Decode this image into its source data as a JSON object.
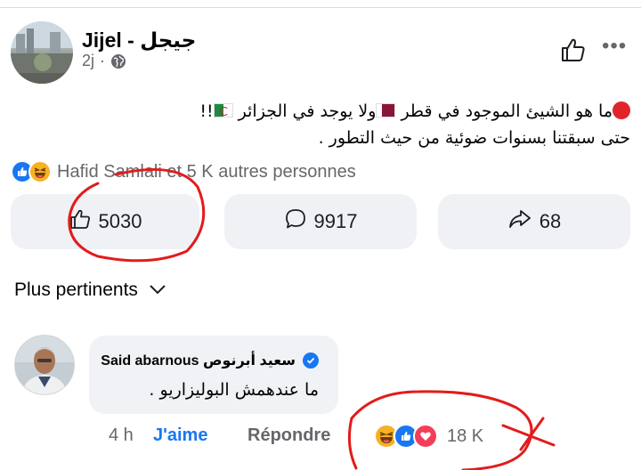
{
  "post": {
    "page_name": "Jijel - جيجل",
    "time": "2j",
    "audience_icon": "globe-icon",
    "line1_a": "ما هو الشيئ الموجود في قطر",
    "line1_b": "ولا يوجد في الجزائر",
    "line1_c": "!!",
    "line2": "حتى سبقتنا بسنوات ضوئية من حيث التطور  ."
  },
  "reactions": {
    "icons": [
      "like-icon",
      "haha-icon"
    ],
    "summary": "Hafid Samlali et 5 K autres personnes"
  },
  "actions": {
    "like_count": "5030",
    "comment_count": "9917",
    "share_count": "68"
  },
  "sort": {
    "label": "Plus pertinents"
  },
  "comment": {
    "author": "Said abarnous سعيد أبرنوص",
    "verified": true,
    "text": "ما عندهمش البوليزاريو .",
    "time": "4 h",
    "like_label": "J'aime",
    "reply_label": "Répondre",
    "reaction_icons": [
      "haha-icon",
      "like-icon",
      "love-icon"
    ],
    "reaction_count": "18 K"
  },
  "colors": {
    "facebook_blue": "#1877f2",
    "muted_text": "#65676b",
    "button_bg": "#eff1f4",
    "annotation_red": "#e31b1b"
  }
}
